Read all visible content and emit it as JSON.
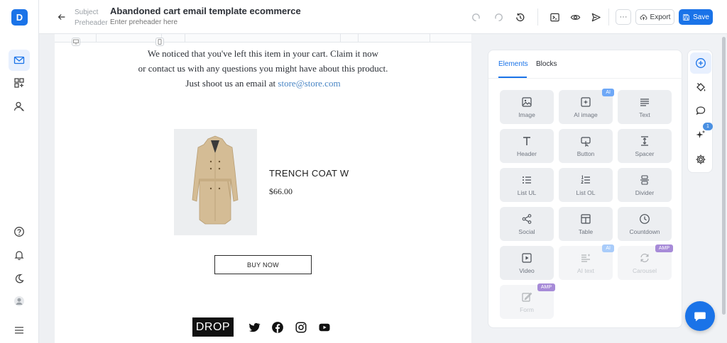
{
  "app": {
    "logo_letter": "D"
  },
  "header": {
    "subject_label": "Subject",
    "subject_value": "Abandoned cart email template ecommerce",
    "preheader_label": "Preheader",
    "preheader_placeholder": "Enter preheader here",
    "export_label": "Export",
    "save_label": "Save",
    "more_label": "···"
  },
  "email": {
    "line1": "We noticed that you've left this item in your cart. Claim it now",
    "line2": "or contact us with any questions you might have about this product.",
    "line3_prefix": "Just shoot us an email at ",
    "line3_link": "store@store.com",
    "product_name": "TRENCH COAT W",
    "product_price": "$66.00",
    "buy_button": "BUY NOW",
    "footer_logo": "DROP"
  },
  "panel": {
    "tabs": [
      {
        "label": "Elements",
        "active": true
      },
      {
        "label": "Blocks",
        "active": false
      }
    ],
    "tiles": [
      {
        "label": "Image",
        "icon": "image-icon"
      },
      {
        "label": "AI image",
        "icon": "ai-image-icon",
        "badge": "AI"
      },
      {
        "label": "Text",
        "icon": "text-icon"
      },
      {
        "label": "Header",
        "icon": "header-icon"
      },
      {
        "label": "Button",
        "icon": "button-icon"
      },
      {
        "label": "Spacer",
        "icon": "spacer-icon"
      },
      {
        "label": "List UL",
        "icon": "list-ul-icon"
      },
      {
        "label": "List OL",
        "icon": "list-ol-icon"
      },
      {
        "label": "Divider",
        "icon": "divider-icon"
      },
      {
        "label": "Social",
        "icon": "social-icon"
      },
      {
        "label": "Table",
        "icon": "table-icon"
      },
      {
        "label": "Countdown",
        "icon": "countdown-icon"
      },
      {
        "label": "Video",
        "icon": "video-icon"
      },
      {
        "label": "AI text",
        "icon": "ai-text-icon",
        "badge": "AI",
        "disabled": true
      },
      {
        "label": "Carousel",
        "icon": "carousel-icon",
        "badge": "AMP",
        "disabled": true
      },
      {
        "label": "Form",
        "icon": "form-icon",
        "badge": "AMP",
        "disabled": true
      }
    ]
  },
  "side_tools": {
    "notification_count": "1"
  },
  "colors": {
    "accent": "#1a73e8",
    "ai_badge": "#6ea8f7",
    "amp_badge": "#a78bd8",
    "link": "#4a86c5"
  }
}
